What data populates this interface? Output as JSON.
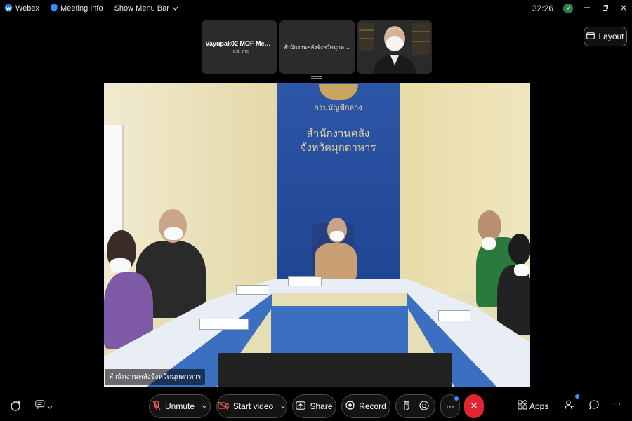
{
  "topbar": {
    "app_name": "Webex",
    "meeting_info": "Meeting Info",
    "show_menu_bar": "Show Menu Bar",
    "timer": "32:26",
    "avatar_initials": "V"
  },
  "participants": [
    {
      "name": "Vayupak02 MOF Meetin...",
      "role": "Host, me"
    },
    {
      "name": "สำนักงานคลังจังหวัดมุกดาหา..."
    },
    {
      "name": ""
    }
  ],
  "layout_label": "Layout",
  "main_video": {
    "panel_line1": "สำนักงานคลัง",
    "panel_line2": "จังหวัดมุกดาหาร",
    "emblem_text": "กรมบัญชีกลาง",
    "caption": "สำนักงานคลังจังหวัดมุกดาหาร"
  },
  "controls": {
    "unmute": "Unmute",
    "start_video": "Start video",
    "share": "Share",
    "record": "Record",
    "more": "···",
    "apps": "Apps"
  },
  "colors": {
    "leave_red": "#e0262e",
    "accent_blue": "#3d8bff"
  }
}
